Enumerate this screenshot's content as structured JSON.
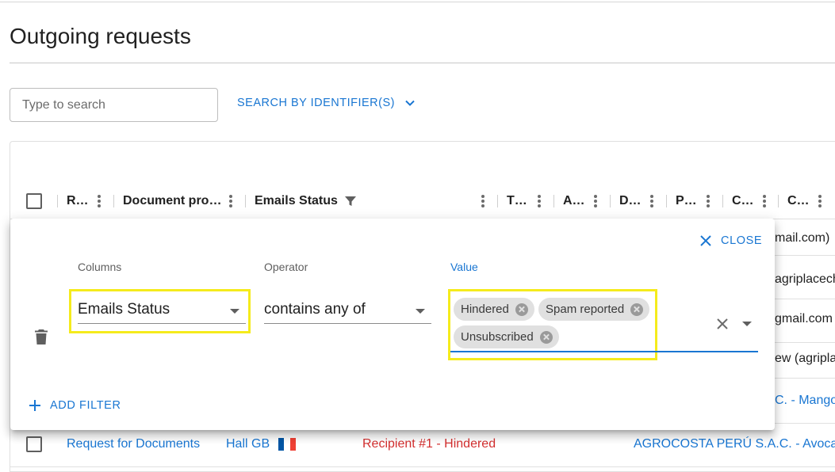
{
  "page": {
    "title": "Outgoing requests"
  },
  "search": {
    "placeholder": "Type to search",
    "identifier_button": "SEARCH BY IDENTIFIER(S)"
  },
  "grid": {
    "columns": [
      "R…",
      "Document pro…",
      "Emails Status",
      "T…",
      "A…",
      "D…",
      "P…",
      "C…",
      "C…"
    ],
    "rows": [
      {
        "partial_text": "mail.com)"
      },
      {
        "partial_text": "agriplacecha"
      },
      {
        "partial_text": "gmail.com"
      },
      {
        "partial_text": "ew (agripla"
      },
      {
        "partial_text": "C. - Mango"
      },
      {
        "name": "Request for Documents",
        "document_provider": "Hall GB",
        "emails_status": "Recipient #1 - Hindered",
        "company": "AGROCOSTA PERÚ S.A.C. - Avocad"
      }
    ]
  },
  "filter_panel": {
    "close_label": "CLOSE",
    "columns_label": "Columns",
    "operator_label": "Operator",
    "value_label": "Value",
    "column_value": "Emails Status",
    "operator_value": "contains any of",
    "chips": [
      "Hindered",
      "Spam reported",
      "Unsubscribed"
    ],
    "add_filter_label": "ADD FILTER"
  },
  "colors": {
    "accent": "#1976d2",
    "error": "#d32f2f",
    "highlight": "#f5eb1c",
    "flag": [
      "#0055a4",
      "#ffffff",
      "#ef4135"
    ]
  }
}
